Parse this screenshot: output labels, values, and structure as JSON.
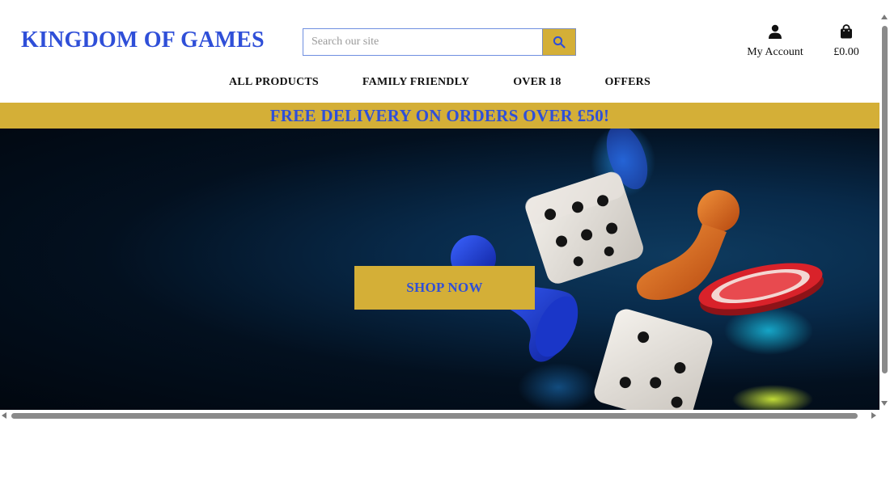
{
  "header": {
    "brand": "KINGDOM OF GAMES",
    "search": {
      "placeholder": "Search our site",
      "button_icon": "search-icon"
    },
    "account": {
      "label": "My Account",
      "icon": "user-icon"
    },
    "cart": {
      "total": "£0.00",
      "icon": "shopping-bag-icon"
    }
  },
  "nav": {
    "items": [
      {
        "label": "ALL PRODUCTS"
      },
      {
        "label": "FAMILY FRIENDLY"
      },
      {
        "label": "OVER 18"
      },
      {
        "label": "OFFERS"
      }
    ]
  },
  "banner": {
    "text": "FREE DELIVERY ON ORDERS OVER £50!"
  },
  "hero": {
    "cta_label": "SHOP NOW",
    "image": "board-game-dice-and-pieces"
  },
  "colors": {
    "brand_blue": "#2f4fd8",
    "gold": "#d4af37",
    "hero_dark": "#03101f"
  }
}
